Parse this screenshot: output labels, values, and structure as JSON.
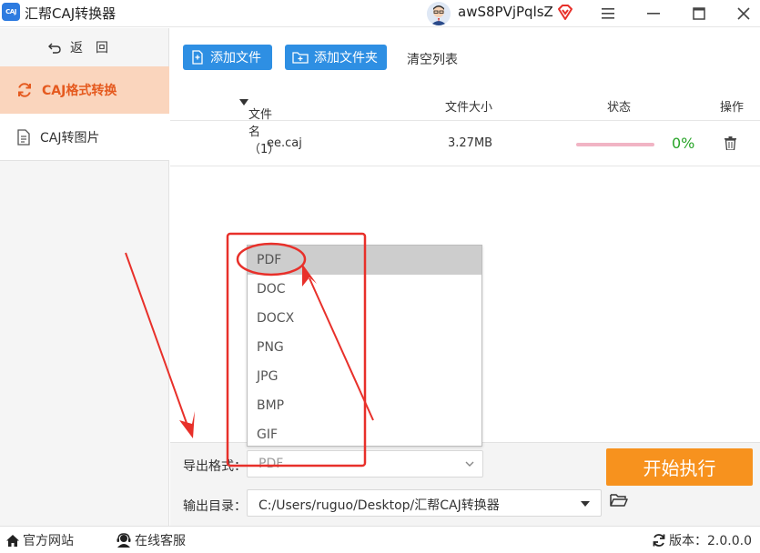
{
  "app": {
    "logo_text": "CAJ",
    "title": "汇帮CAJ转换器",
    "username": "awS8PVjPqlsZ"
  },
  "sidebar": {
    "back_label": "返回",
    "items": [
      {
        "label": "CAJ格式转换",
        "active": true,
        "icon": "refresh-icon"
      },
      {
        "label": "CAJ转图片",
        "active": false,
        "icon": "document-icon"
      }
    ]
  },
  "toolbar": {
    "add_file": "添加文件",
    "add_folder": "添加文件夹",
    "clear_list": "清空列表"
  },
  "table": {
    "headers": {
      "name": "文件名（1）",
      "size": "文件大小",
      "status": "状态",
      "op": "操作"
    },
    "rows": [
      {
        "name": "ee.caj",
        "size": "3.27MB",
        "progress": 0,
        "progress_label": "0%"
      }
    ]
  },
  "export": {
    "format_label": "导出格式：",
    "format_value": "PDF",
    "options": [
      "PDF",
      "DOC",
      "DOCX",
      "PNG",
      "JPG",
      "BMP",
      "GIF"
    ],
    "selected_index": 0,
    "output_label": "输出目录：",
    "output_path": "C:/Users/ruguo/Desktop/汇帮CAJ转换器",
    "start_label": "开始执行"
  },
  "statusbar": {
    "website": "官方网站",
    "service": "在线客服",
    "version": "版本：2.0.0.0"
  },
  "colors": {
    "accent_blue": "#2e8fe3",
    "accent_orange": "#f7921e",
    "sidebar_active_bg": "#fad5bd",
    "sidebar_active_text": "#e55a1f",
    "progress_green": "#28a428",
    "annotation_red": "#e8302a"
  }
}
